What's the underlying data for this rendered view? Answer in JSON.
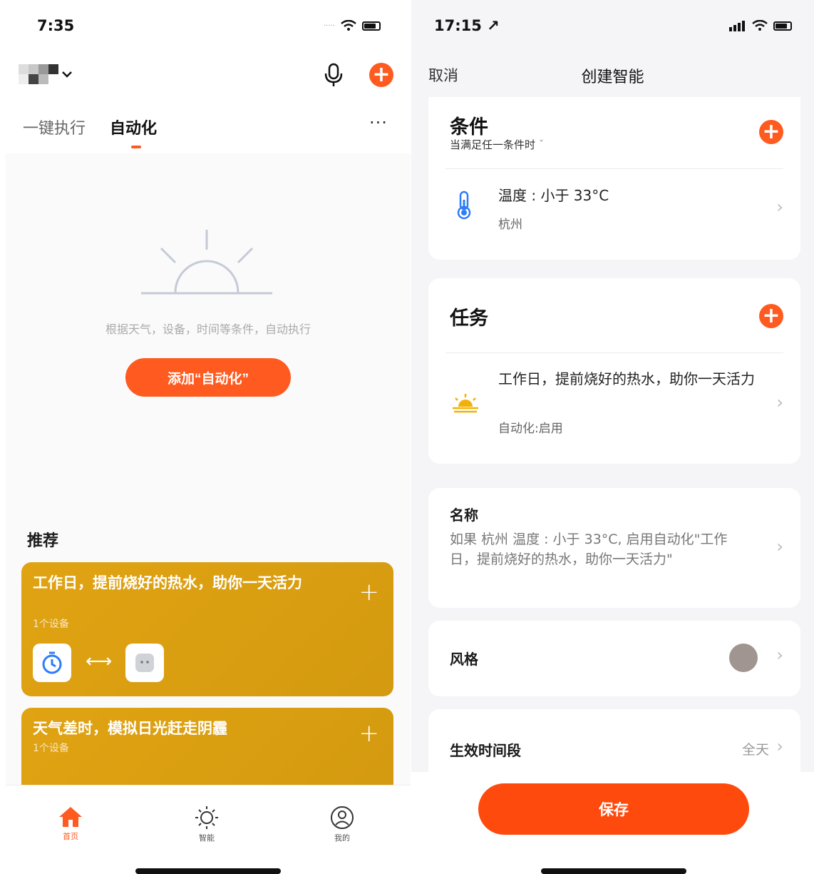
{
  "left": {
    "status": {
      "time": "7:35"
    },
    "header": {
      "home_name_hidden": true
    },
    "tabs": [
      {
        "label": "一键执行",
        "active": false
      },
      {
        "label": "自动化",
        "active": true
      }
    ],
    "more_label": "···",
    "empty": {
      "text": "根据天气，设备，时间等条件，自动执行",
      "button_label": "添加“自动化”"
    },
    "recommend": {
      "title": "推荐",
      "cards": [
        {
          "title": "工作日，提前烧好的热水，助你一天活力",
          "subtitle": "1个设备",
          "plus": "+",
          "arrow": "⟷"
        },
        {
          "title": "天气差时，模拟日光赶走阴霾",
          "subtitle": "1个设备",
          "plus": "+"
        }
      ]
    },
    "tabbar": [
      {
        "label": "首页",
        "icon": "home-icon",
        "active": true
      },
      {
        "label": "智能",
        "icon": "sun-icon",
        "active": false
      },
      {
        "label": "我的",
        "icon": "profile-icon",
        "active": false
      }
    ],
    "accent": "#ff5a1f"
  },
  "right": {
    "status": {
      "time": "17:15 ↗"
    },
    "nav": {
      "cancel": "取消",
      "title": "创建智能"
    },
    "condition": {
      "title": "条件",
      "mode": "当满足任一条件时",
      "mode_caret": "ˇ",
      "item": {
        "main": "温度 : 小于 33°C",
        "sub": "杭州"
      }
    },
    "task": {
      "title": "任务",
      "item": {
        "main": "工作日，提前烧好的热水，助你一天活力",
        "sub": "自动化:启用"
      }
    },
    "name": {
      "label": "名称",
      "value": "如果 杭州 温度 : 小于 33°C, 启用自动化\"工作日，提前烧好的热水，助你一天活力\""
    },
    "style": {
      "label": "风格",
      "color": "#a09590"
    },
    "period": {
      "label": "生效时间段",
      "value": "全天"
    },
    "save_label": "保存",
    "accent": "#ff4a0e"
  }
}
